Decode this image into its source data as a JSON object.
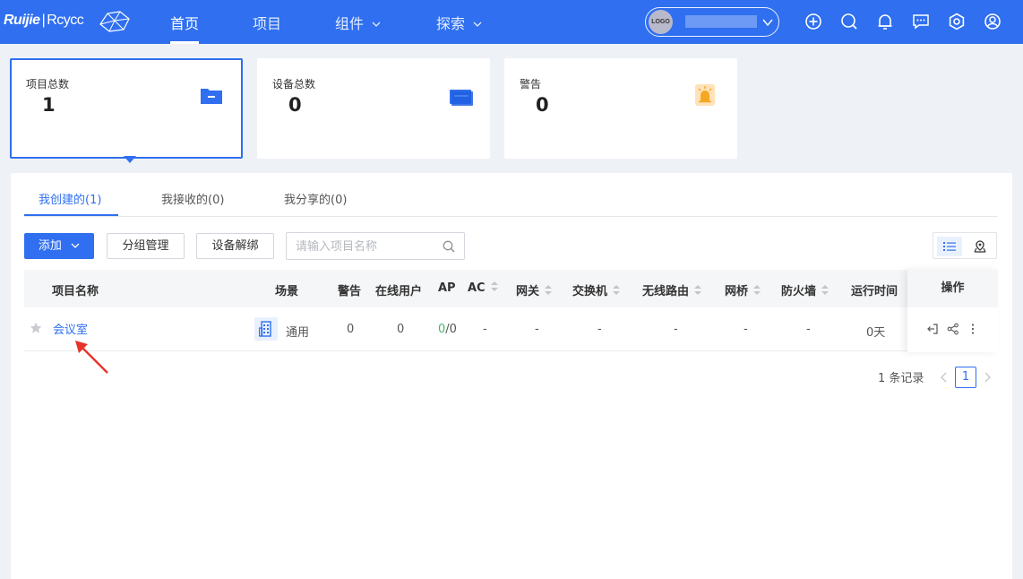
{
  "app": {
    "brand": "Ruijie",
    "brand_separator": "|",
    "product": "Rcycc"
  },
  "nav": {
    "items": [
      {
        "label": "首页",
        "active": true
      },
      {
        "label": "项目",
        "active": false
      },
      {
        "label": "组件",
        "active": false,
        "has_dropdown": true
      },
      {
        "label": "探索",
        "active": false,
        "has_dropdown": true
      }
    ]
  },
  "tenant": {
    "logo_text": "LOGO",
    "name": ""
  },
  "top_icons": [
    "plus-circle-icon",
    "search-icon",
    "bell-icon",
    "message-icon",
    "gear-icon",
    "user-icon"
  ],
  "stats": [
    {
      "label": "项目总数",
      "value": "1",
      "icon": "folder-icon",
      "selected": true
    },
    {
      "label": "设备总数",
      "value": "0",
      "icon": "device-icon",
      "selected": false
    },
    {
      "label": "警告",
      "value": "0",
      "icon": "alarm-icon",
      "selected": false
    }
  ],
  "tabs": [
    {
      "label": "我创建的(1)",
      "active": true
    },
    {
      "label": "我接收的(0)",
      "active": false
    },
    {
      "label": "我分享的(0)",
      "active": false
    }
  ],
  "toolbar": {
    "add_label": "添加",
    "group_label": "分组管理",
    "unbind_label": "设备解绑",
    "search_placeholder": "请输入项目名称"
  },
  "table": {
    "columns": [
      {
        "label": "项目名称",
        "sortable": false
      },
      {
        "label": "场景",
        "sortable": false
      },
      {
        "label": "警告",
        "sortable": false
      },
      {
        "label": "在线用户",
        "sortable": false
      },
      {
        "label": "AP",
        "sortable": false
      },
      {
        "label": "AC",
        "sortable": true
      },
      {
        "label": "网关",
        "sortable": true
      },
      {
        "label": "交换机",
        "sortable": true
      },
      {
        "label": "无线路由",
        "sortable": true
      },
      {
        "label": "网桥",
        "sortable": true
      },
      {
        "label": "防火墙",
        "sortable": true
      },
      {
        "label": "运行时间",
        "sortable": false
      },
      {
        "label": "操作",
        "sortable": false
      }
    ],
    "rows": [
      {
        "starred": false,
        "name": "会议室",
        "scene": "通用",
        "alerts": "0",
        "online_users": "0",
        "ap_online": "0",
        "ap_sep_total": "/0",
        "ac": "-",
        "gateway": "-",
        "switch": "-",
        "wireless_router": "-",
        "bridge": "-",
        "firewall": "-",
        "uptime": "0天",
        "actions": [
          "enter-icon",
          "share-icon",
          "more-icon"
        ]
      }
    ]
  },
  "pagination": {
    "total_text": "1 条记录",
    "current_page": "1"
  },
  "colors": {
    "primary": "#2f6ff0",
    "online": "#3fb86a",
    "annotation": "#e8322c"
  }
}
